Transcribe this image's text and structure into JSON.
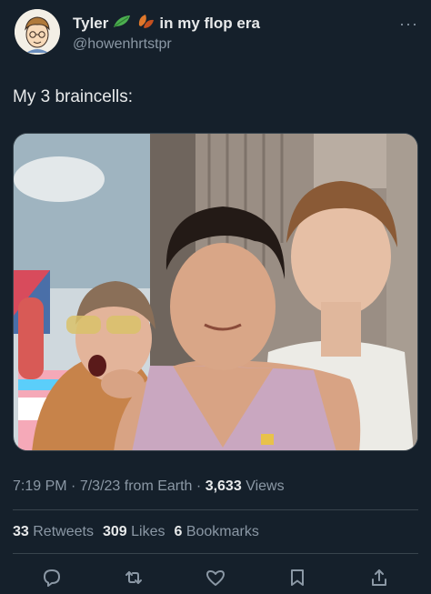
{
  "author": {
    "display_name": "Tyler",
    "name_suffix": "in my flop era",
    "handle": "@howenhrtstpr",
    "emoji_icons": [
      "leaf-icon",
      "autumn-leaves-icon"
    ]
  },
  "tweet": {
    "text": "My 3 braincells:"
  },
  "meta": {
    "time": "7:19 PM",
    "date": "7/3/23",
    "source": "from Earth",
    "views_count": "3,633",
    "views_label": "Views"
  },
  "stats": {
    "retweets_count": "33",
    "retweets_label": "Retweets",
    "likes_count": "309",
    "likes_label": "Likes",
    "bookmarks_count": "6",
    "bookmarks_label": "Bookmarks"
  },
  "actions": [
    "reply-icon",
    "retweet-icon",
    "like-icon",
    "bookmark-icon",
    "share-icon"
  ],
  "colors": {
    "background": "#15202b",
    "primary_text": "#e7e9ea",
    "secondary_text": "#8b98a5",
    "divider": "#38444d"
  }
}
